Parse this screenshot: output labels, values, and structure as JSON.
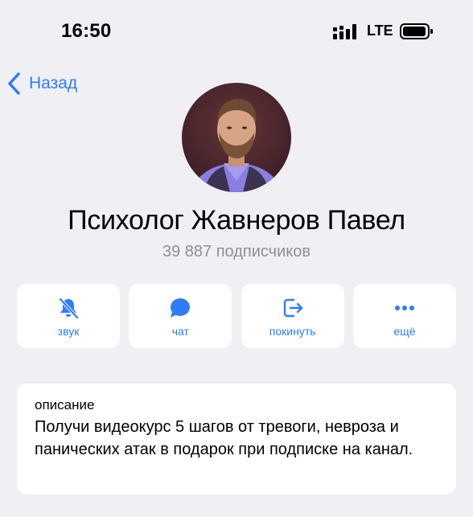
{
  "status_bar": {
    "time": "16:50",
    "network": "LTE",
    "icons": [
      "signal-icon",
      "battery-icon"
    ]
  },
  "nav": {
    "back_label": "Назад",
    "back_icon": "chevron-left-icon",
    "accent_color": "#2f7cf6"
  },
  "profile": {
    "avatar": "avatar",
    "title": "Психолог Жавнеров Павел",
    "subscribers": "39 887 подписчиков"
  },
  "actions": [
    {
      "icon": "bell-muted-icon",
      "label": "звук"
    },
    {
      "icon": "chat-bubble-icon",
      "label": "чат"
    },
    {
      "icon": "leave-icon",
      "label": "покинуть"
    },
    {
      "icon": "more-icon",
      "label": "ещё"
    }
  ],
  "description": {
    "title": "описание",
    "text": "Получи видеокурс 5 шагов от тревоги, невроза и панических атак в подарок при подписке на канал."
  },
  "colors": {
    "background": "#efeff4",
    "card": "#ffffff",
    "accent": "#2f7cf6",
    "secondary_text": "#8e8e93"
  }
}
